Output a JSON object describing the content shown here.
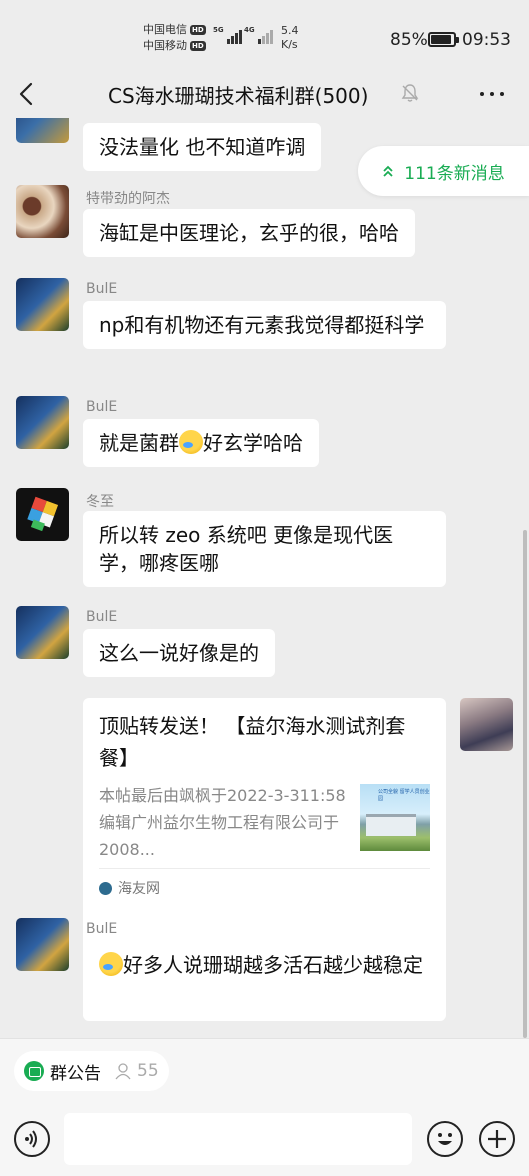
{
  "status_bar": {
    "carrier1": "中国电信",
    "carrier2": "中国移动",
    "hd": "HD",
    "net1": "5G",
    "net2": "4G",
    "speed_value": "5.4",
    "speed_unit": "K/s",
    "battery": "85%",
    "battery_level": 0.85,
    "time": "09:53"
  },
  "header": {
    "title": "CS海水珊瑚技术福利群(500)"
  },
  "new_messages": {
    "label": "111条新消息"
  },
  "messages": [
    {
      "sender": "",
      "text": "没法量化   也不知道咋调"
    },
    {
      "sender": "特带劲的阿杰",
      "text": "海缸是中医理论，玄乎的很，哈哈"
    },
    {
      "sender": "BulE",
      "text": "np和有机物还有元素我觉得都挺科学"
    },
    {
      "sender": "BulE",
      "text_before": "就是菌群",
      "text_after": "好玄学哈哈"
    },
    {
      "sender": "冬至",
      "text": "所以转 zeo 系统吧 更像是现代医学，哪疼医哪"
    },
    {
      "sender": "BulE",
      "text": "这么一说好像是的"
    },
    {
      "sender": "BulE",
      "text": "好多人说珊瑚越多活石越少越稳定"
    }
  ],
  "card": {
    "title": "顶贴转发送！ 【益尔海水测试剂套餐】",
    "desc": "本帖最后由飒枫于2022-3-311:58编辑广州益尔生物工程有限公司于2008...",
    "thumb_text": "公司全貌 留学人员创业园",
    "source": "海友网"
  },
  "bottom": {
    "notice_label": "群公告",
    "member_count": "55",
    "input_value": ""
  },
  "icons": {
    "back": "back-arrow-icon",
    "mute": "mute-bell-icon",
    "more": "more-dots-icon",
    "voice": "voice-icon",
    "emoji": "emoji-icon",
    "plus": "plus-icon"
  },
  "colors": {
    "accent": "#19ac53",
    "background": "#ededed",
    "bubble": "#ffffff"
  }
}
